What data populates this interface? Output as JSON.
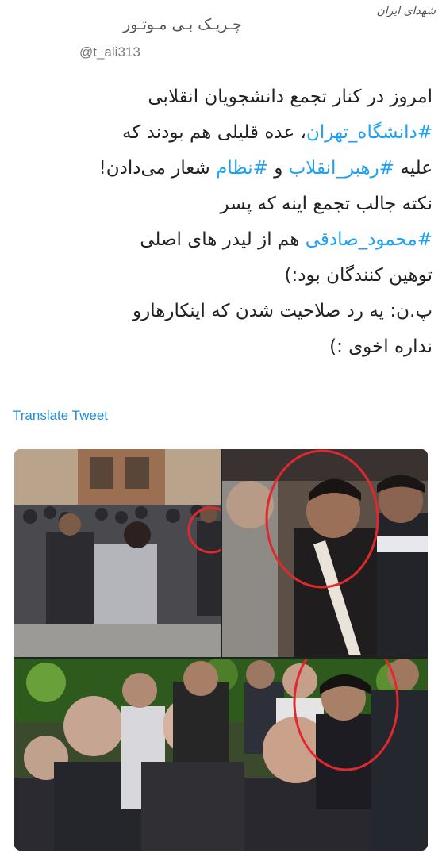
{
  "watermark": {
    "text": "شهدای ایران"
  },
  "author": {
    "name": "چـریـک بـی مـوتـور",
    "handle": "@t_ali313"
  },
  "tweet": {
    "line1": "امروز در کنار تجمع دانشجویان انقلابی",
    "line2_hashtag": "#دانشگاه_تهران",
    "line2_text": "، عده قلیلی هم بودند که",
    "line3_text_a": "علیه ",
    "line3_hashtag_a": "#رهبر_انقلاب",
    "line3_text_b": " و ",
    "line3_hashtag_b": "#نظام",
    "line3_text_c": " شعار می‌دادن!",
    "line4": "نکته جالب تجمع اینه که پسر",
    "line5_hashtag": "#محمود_صادقی",
    "line5_text": " هم از لیدر های اصلی",
    "line6": "توهین کنندگان بود:)",
    "line7": "پ.ن: یه رد صلاحیت شدن که اینکارهارو",
    "line8": "نداره اخوی :)"
  },
  "translate_label": "Translate Tweet",
  "colors": {
    "hashtag": "#1da1f2",
    "link": "#1d8fd9",
    "circle": "#e0282e"
  }
}
